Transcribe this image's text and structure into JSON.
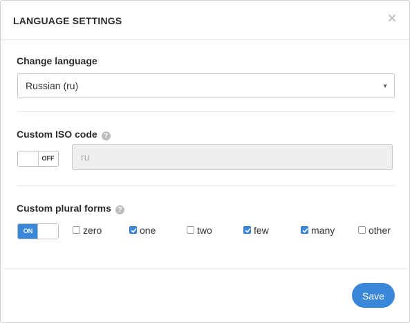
{
  "dialog": {
    "title": "LANGUAGE SETTINGS",
    "close_icon": "close-icon"
  },
  "change_language": {
    "label": "Change language",
    "selected": "Russian (ru)"
  },
  "custom_iso": {
    "label": "Custom ISO code",
    "help": "?",
    "toggle_state": "OFF",
    "input_value": "ru"
  },
  "plural_forms": {
    "label": "Custom plural forms",
    "help": "?",
    "toggle_state": "ON",
    "options": [
      {
        "label": "zero",
        "checked": false
      },
      {
        "label": "one",
        "checked": true
      },
      {
        "label": "two",
        "checked": false
      },
      {
        "label": "few",
        "checked": true
      },
      {
        "label": "many",
        "checked": true
      },
      {
        "label": "other",
        "checked": false
      }
    ]
  },
  "footer": {
    "save_label": "Save"
  },
  "colors": {
    "accent": "#3a86d8",
    "disabled_bg": "#efefef"
  }
}
